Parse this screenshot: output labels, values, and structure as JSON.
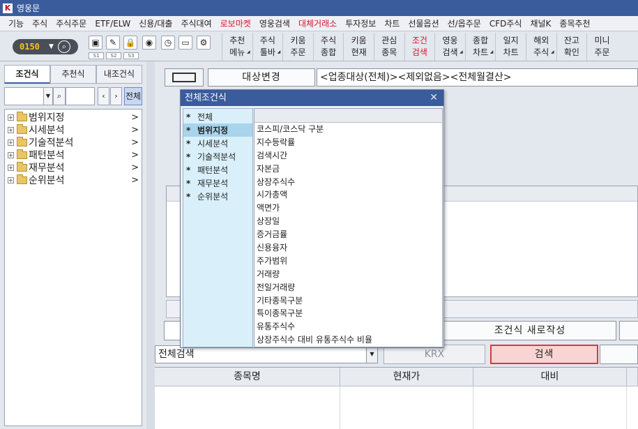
{
  "window": {
    "title": "영웅문"
  },
  "menu": {
    "items": [
      {
        "label": "기능"
      },
      {
        "label": "주식"
      },
      {
        "label": "주식주문"
      },
      {
        "label": "ETF/ELW"
      },
      {
        "label": "신용/대출"
      },
      {
        "label": "주식대여"
      },
      {
        "label": "로보마켓",
        "highlight": true
      },
      {
        "label": "영웅검색"
      },
      {
        "label": "대체거래소",
        "highlight": true
      },
      {
        "label": "투자정보"
      },
      {
        "label": "차트"
      },
      {
        "label": "선물옵션"
      },
      {
        "label": "선/옵주문"
      },
      {
        "label": "CFD주식"
      },
      {
        "label": "채널K"
      },
      {
        "label": "종목추천"
      }
    ]
  },
  "toolbar": {
    "code_value": "0150",
    "slots": [
      "S1",
      "S2",
      "S3"
    ],
    "buttons": [
      {
        "line1": "추천",
        "line2": "메뉴",
        "caret": true
      },
      {
        "line1": "주식",
        "line2": "툴바",
        "caret": true
      },
      {
        "line1": "키움",
        "line2": "주문"
      },
      {
        "line1": "주식",
        "line2": "종합"
      },
      {
        "line1": "키움",
        "line2": "현재"
      },
      {
        "line1": "관심",
        "line2": "종목"
      },
      {
        "line1": "조건",
        "line2": "검색",
        "highlight": true
      },
      {
        "line1": "영웅",
        "line2": "검색",
        "caret": true
      },
      {
        "line1": "종합",
        "line2": "차트",
        "caret": true
      },
      {
        "line1": "일지",
        "line2": "차트"
      },
      {
        "line1": "해외",
        "line2": "주식",
        "caret": true
      },
      {
        "line1": "잔고",
        "line2": "확인"
      },
      {
        "line1": "미니",
        "line2": "주문"
      }
    ]
  },
  "left_panel": {
    "tabs": [
      "조건식",
      "추천식",
      "내조건식"
    ],
    "all_label": "전체",
    "tree": [
      "범위지정",
      "시세분석",
      "기술적분석",
      "패턴분석",
      "재무분석",
      "순위분석"
    ]
  },
  "right_panel": {
    "target_button": "대상변경",
    "target_text": "<업종대상(전체)><제외없음><전체월결산>",
    "new_condition_button": "조건식 새로작성",
    "scope_select": "전체검색",
    "krx_button": "KRX",
    "search_button": "검색",
    "table_headers": [
      "종목명",
      "현재가",
      "대비"
    ]
  },
  "popup": {
    "title": "전체조건식",
    "categories": [
      "전체",
      "범위지정",
      "시세분석",
      "기술적분석",
      "패턴분석",
      "재무분석",
      "순위분석"
    ],
    "selected_category": "범위지정",
    "fields": [
      "코스피/코스닥 구분",
      "지수등락률",
      "검색시간",
      "자본금",
      "상장주식수",
      "시가총액",
      "액면가",
      "상장일",
      "증거금률",
      "신용융자",
      "주가범위",
      "거래량",
      "전일거래량",
      "기타종목구분",
      "특이종목구분",
      "유통주식수",
      "상장주식수 대비 유통주식수 비율"
    ]
  }
}
